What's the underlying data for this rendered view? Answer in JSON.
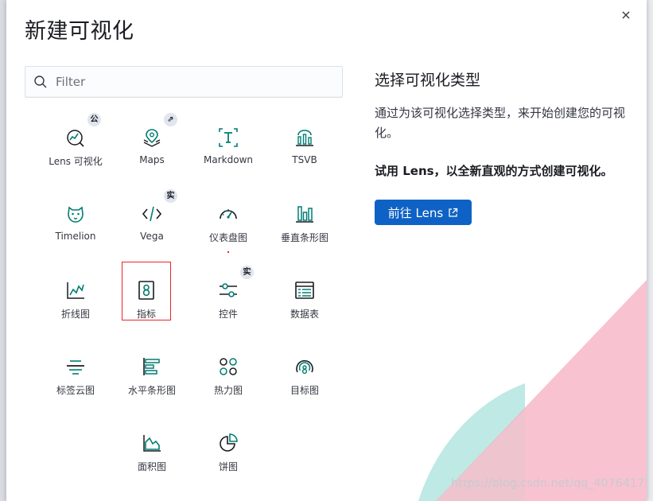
{
  "modal": {
    "title": "新建可视化",
    "close_label": "×"
  },
  "search": {
    "placeholder": "Filter",
    "value": ""
  },
  "tiles": [
    {
      "label": "Lens 可视化",
      "icon": "lens-icon",
      "badge": "公"
    },
    {
      "label": "Maps",
      "icon": "maps-icon",
      "badge": "⇗"
    },
    {
      "label": "Markdown",
      "icon": "markdown-icon",
      "badge": ""
    },
    {
      "label": "TSVB",
      "icon": "tsvb-icon",
      "badge": ""
    },
    {
      "label": "Timelion",
      "icon": "timelion-icon",
      "badge": ""
    },
    {
      "label": "Vega",
      "icon": "vega-icon",
      "badge": "实"
    },
    {
      "label": "仪表盘图",
      "icon": "gauge-icon",
      "badge": ""
    },
    {
      "label": "垂直条形图",
      "icon": "vertical-bar-icon",
      "badge": ""
    },
    {
      "label": "折线图",
      "icon": "line-chart-icon",
      "badge": ""
    },
    {
      "label": "指标",
      "icon": "metric-icon",
      "badge": ""
    },
    {
      "label": "控件",
      "icon": "controls-icon",
      "badge": "实"
    },
    {
      "label": "数据表",
      "icon": "data-table-icon",
      "badge": ""
    },
    {
      "label": "标签云图",
      "icon": "tag-cloud-icon",
      "badge": ""
    },
    {
      "label": "水平条形图",
      "icon": "horizontal-bar-icon",
      "badge": ""
    },
    {
      "label": "热力图",
      "icon": "heatmap-icon",
      "badge": ""
    },
    {
      "label": "目标图",
      "icon": "goal-icon",
      "badge": ""
    },
    {
      "label": "面积图",
      "icon": "area-chart-icon",
      "badge": ""
    },
    {
      "label": "饼图",
      "icon": "pie-chart-icon",
      "badge": ""
    }
  ],
  "selected_tile": "指标",
  "side_panel": {
    "title": "选择可视化类型",
    "description": "通过为该可视化选择类型，来开始创建您的可视化。",
    "lens_promo": "试用 Lens，以全新直观的方式创建可视化。",
    "lens_button": "前往 Lens"
  },
  "watermark": "https://blog.csdn.net/qq_40764171",
  "colors": {
    "icon_teal": "#017d73",
    "button_blue": "#0f62c5",
    "selection_red": "#e7262b",
    "deco_pink": "#f6b3c5",
    "deco_mint": "#a8e2dc"
  }
}
